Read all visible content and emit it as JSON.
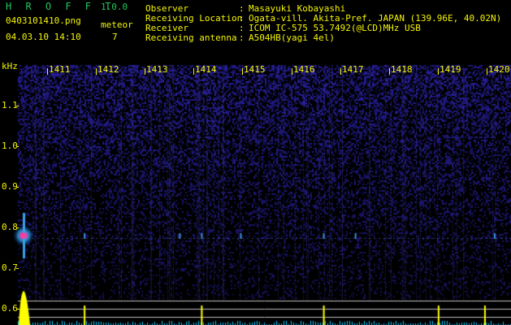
{
  "header": {
    "title": "H R O F F T",
    "version": "1.0.0",
    "filename": "0403101410.png",
    "datetime": "04.03.10 14:10",
    "meteor_label": "meteor",
    "meteor_count": "7"
  },
  "info": [
    {
      "label": "Observer",
      "sep": ":",
      "value": "Masayuki Kobayashi"
    },
    {
      "label": "Receiving Location",
      "sep": ":",
      "value": "Ogata-vill. Akita-Pref. JAPAN (139.96E, 40.02N)"
    },
    {
      "label": "Receiver",
      "sep": ":",
      "value": "ICOM IC-575 53.7492(@LCD)MHz USB"
    },
    {
      "label": "Receiving antenna",
      "sep": ":",
      "value": "A504HB(yagi 4el)"
    }
  ],
  "colors": {
    "text_yellow": "#f5f506",
    "text_green": "#22c55e",
    "background": "#000000",
    "noise": "#1a1a7a",
    "meteor_head": "#ff3aa0",
    "power_trace": "#ffff00",
    "baseline": "#00c8ff"
  },
  "chart_data": {
    "type": "heatmap",
    "title": "",
    "ylabel": "kHz",
    "xlabel": "",
    "x_ticks": [
      "1411",
      "1412",
      "1413",
      "1414",
      "1415",
      "1416",
      "1417",
      "1418",
      "1419",
      "1420"
    ],
    "y_ticks": [
      "1.1",
      "1.0",
      "0.9",
      "0.8",
      "0.7",
      "0.6"
    ],
    "ylim": [
      0.56,
      1.2
    ],
    "xlim": [
      1410.3,
      1420.4
    ],
    "meteor_band_khz": 0.78,
    "meteor_events_min": [
      1410.45,
      1411.65,
      1413.6,
      1414.05,
      1414.85,
      1416.55,
      1417.2,
      1420.05
    ],
    "power_spikes_min": [
      1410.45,
      1411.65,
      1414.05,
      1416.55,
      1418.9,
      1419.85
    ],
    "grid": false,
    "legend": "none"
  }
}
